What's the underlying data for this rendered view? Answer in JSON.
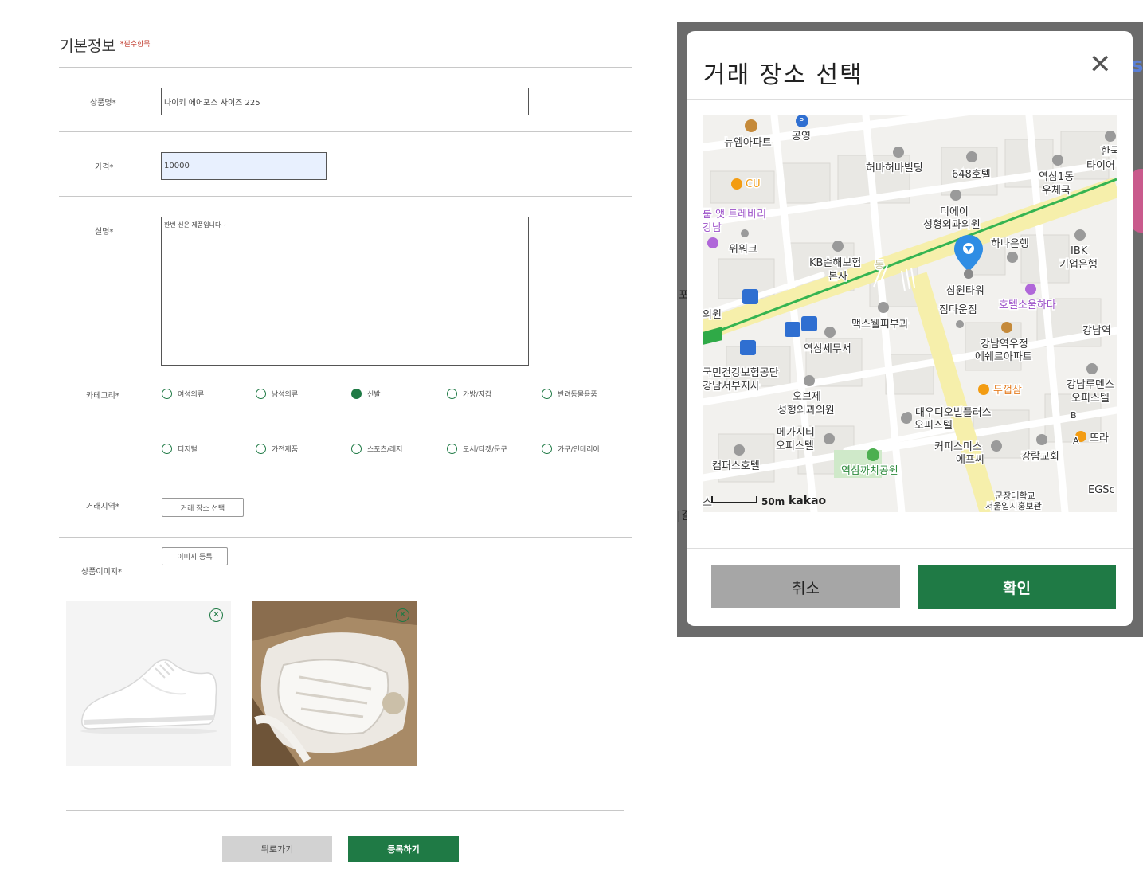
{
  "form": {
    "section_title": "기본정보",
    "required_note": "*필수항목",
    "name_label": "상품명*",
    "name_value": "나이키 에어포스 사이즈 225",
    "price_label": "가격*",
    "price_value": "10000",
    "desc_label": "설명*",
    "desc_value": "한번 신은 제품입니다~",
    "category_label": "카테고리*",
    "categories": [
      {
        "label": "여성의류",
        "checked": false
      },
      {
        "label": "남성의류",
        "checked": false
      },
      {
        "label": "신발",
        "checked": true
      },
      {
        "label": "가방/지갑",
        "checked": false
      },
      {
        "label": "반려동물용품",
        "checked": false
      },
      {
        "label": "디지털",
        "checked": false
      },
      {
        "label": "가전제품",
        "checked": false
      },
      {
        "label": "스포츠/레저",
        "checked": false
      },
      {
        "label": "도서/티켓/문구",
        "checked": false
      },
      {
        "label": "가구/인테리어",
        "checked": false
      }
    ],
    "region_label": "거래지역*",
    "region_button": "거래 장소 선택",
    "image_label": "상품이미지*",
    "image_button": "이미지 등록",
    "back_button": "뒤로가기",
    "submit_button": "등록하기"
  },
  "colors": {
    "accent": "#1f7a45",
    "cancel_gray": "#a6a6a6",
    "back_gray": "#d2d2d2",
    "overlay": "#6b6b6b"
  },
  "modal": {
    "title": "거래 장소 선택",
    "close_icon": "close-icon",
    "cancel_button": "취소",
    "confirm_button": "확인",
    "map": {
      "selected_marker": "location-pin-icon",
      "scale_text": "50m",
      "provider": "kakao",
      "labels": {
        "p1": "뉴엠아파트",
        "p2": "공영",
        "p3": "CU",
        "p4": "허바허바빌딩",
        "p5": "648호텔",
        "p6": "역삼1동",
        "p7": "우체국",
        "p8": "한국",
        "p9": "타이어",
        "p10": "디에이",
        "p11": "성형외과의원",
        "p12": "룸 앳 트레바리",
        "p13": "강남",
        "p14": "위워크",
        "p15": "KB손해보험",
        "p16": "본사",
        "p17": "하나은행",
        "p18": "IBK",
        "p19": "기업은행",
        "p20": "삼원타워",
        "p21": "짐다운짐",
        "p22": "호텔소울하다",
        "p23": "의원",
        "p24": "맥스웰피부과",
        "p25": "역삼세무서",
        "p26": "강남역우정",
        "p27": "에쉐르아파트",
        "p28": "강남역",
        "p29": "국민건강보험공단",
        "p30": "강남서부지사",
        "p31": "오브제",
        "p32": "성형외과의원",
        "p33": "두껍삼",
        "p34": "강남루덴스",
        "p35": "오피스텔",
        "p36": "대우디오빌플러스",
        "p37": "오피스텔",
        "p38": "메가시티",
        "p39": "오피스텔",
        "p40": "뜨라",
        "p41": "캠퍼스호텔",
        "p42": "커피스미스",
        "p43": "에프씨",
        "p44": "강람교회",
        "p45": "역삼까치공원",
        "p46": "EGSc",
        "p47": "군장대학교",
        "p48": "서울입시홍보관",
        "p49": "스",
        "p50": "동",
        "p51": "B",
        "p52": "A",
        "p53": "P"
      }
    }
  },
  "page_peek": {
    "right_letter": "s",
    "left_1": "포",
    "left_2": "|결"
  }
}
